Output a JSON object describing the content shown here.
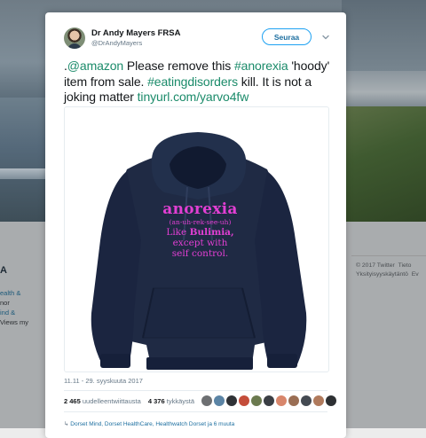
{
  "background": {
    "left_heading": "A",
    "left_lines": [
      "ealth &",
      "nor",
      "ind &",
      "Views my"
    ],
    "right_footer": {
      "copyright": "© 2017 Twitter",
      "next": "Tieto",
      "privacy": "Yksityisyyskäytäntö",
      "next2": "Ev"
    }
  },
  "tweet": {
    "author": {
      "display_name": "Dr Andy Mayers FRSA",
      "handle": "@DrAndyMayers"
    },
    "follow_label": "Seuraa",
    "text_parts": {
      "p1": ".",
      "mention": "@amazon",
      "p2": " Please remove this ",
      "hashtag1": "#anorexia",
      "p3": " 'hoody' item from sale. ",
      "hashtag2": "#eatingdisorders",
      "p4": " kill. It is not a joking matter ",
      "link": "tinyurl.com/yarvo4fw"
    },
    "media": {
      "print_line1": "anorexia",
      "print_line2": "(an-uh-rek-see-uh)",
      "print_line3a": "Like ",
      "print_line3b": "Bulimia,",
      "print_line4": "except with",
      "print_line5": "self control."
    },
    "timestamp": "11.11 - 29. syyskuuta 2017",
    "stats": {
      "retweets": "2 465",
      "retweets_label": "uudelleentwiittausta",
      "likes": "4 376",
      "likes_label": "tykkäystä"
    },
    "replying_prefix": "↳ ",
    "replying_names": "Dorset Mind, Dorset HealthCare, Healthwatch Dorset ja 6 muuta"
  },
  "colors": {
    "accent": "#1da1f2",
    "link": "#1b8b6a",
    "print": "#e23fd3",
    "hoodie": "#1f2a44",
    "liker_avatars": [
      "#6d6f72",
      "#5b84a5",
      "#2f3236",
      "#c44d3a",
      "#6b7a4f",
      "#3a3e44",
      "#d8866b",
      "#9a6e54",
      "#444a52",
      "#b07a5c",
      "#2d3033"
    ]
  },
  "icons": [
    "chevron-down-icon",
    "avatar"
  ]
}
